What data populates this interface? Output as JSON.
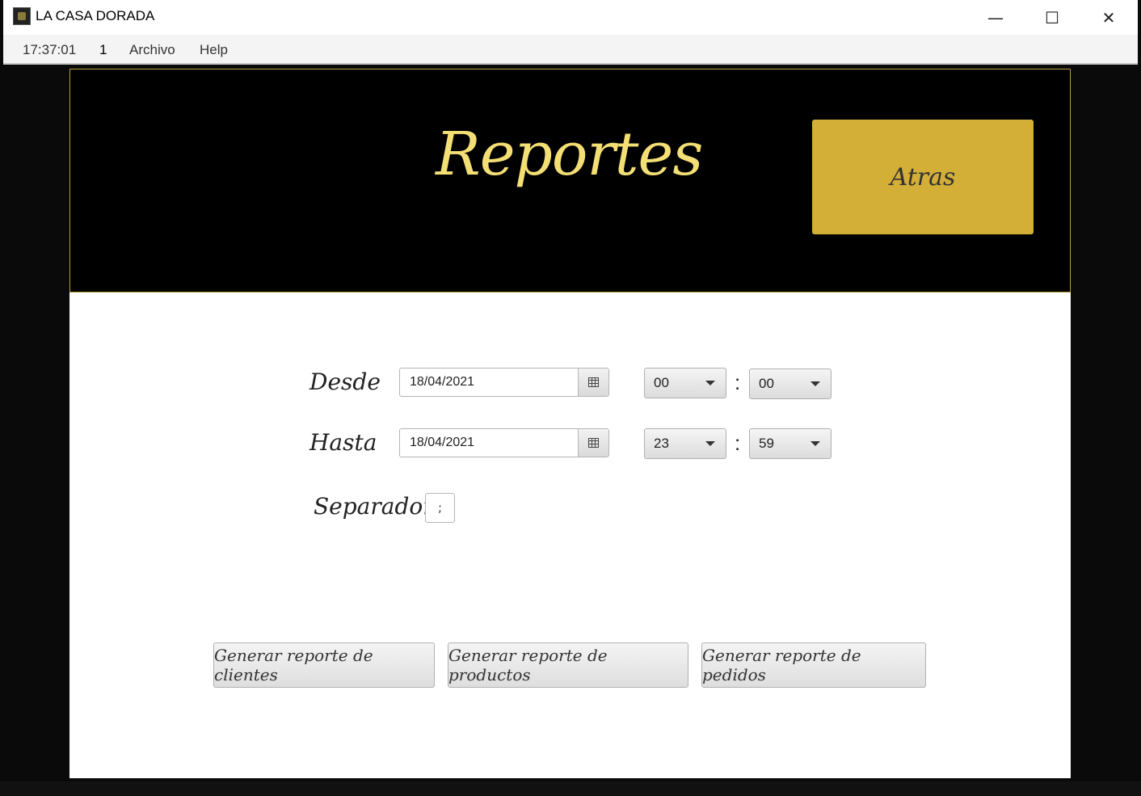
{
  "window": {
    "title": "LA CASA DORADA",
    "minimize_glyph": "—",
    "maximize_glyph": "☐",
    "close_glyph": "✕"
  },
  "menubar": {
    "clock": "17:37:01",
    "counter": "1",
    "items": [
      "Archivo",
      "Help"
    ]
  },
  "header": {
    "title": "Reportes",
    "back_label": "Atras"
  },
  "form": {
    "from": {
      "label": "Desde",
      "date": "18/04/2021",
      "hour": "00",
      "minute": "00"
    },
    "to": {
      "label": "Hasta",
      "date": "18/04/2021",
      "hour": "23",
      "minute": "59"
    },
    "time_separator": ":",
    "separator": {
      "label": "Separador",
      "value": ";"
    }
  },
  "actions": [
    {
      "label": "Generar reporte de clientes"
    },
    {
      "label": "Generar reporte de productos"
    },
    {
      "label": "Generar reporte de pedidos"
    }
  ],
  "colors": {
    "gold_accent": "#d4af37",
    "title_yellow": "#f4df75",
    "header_bg": "#000000"
  },
  "icons": [
    "app-logo-icon",
    "calendar-icon",
    "chevron-down-icon"
  ]
}
